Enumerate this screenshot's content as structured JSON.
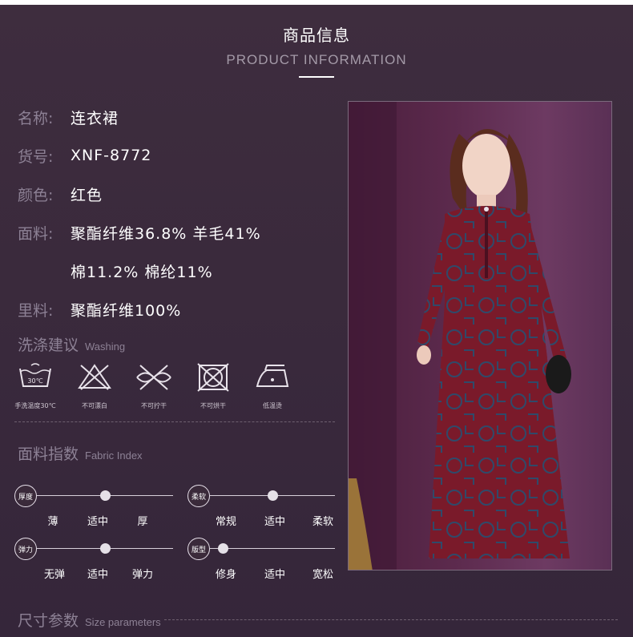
{
  "header": {
    "title_cn": "商品信息",
    "title_en": "PRODUCT INFORMATION"
  },
  "info": {
    "name_label": "名称:",
    "name_value": "连衣裙",
    "sku_label": "货号:",
    "sku_value": "XNF-8772",
    "color_label": "颜色:",
    "color_value": "红色",
    "fabric_label": "面料:",
    "fabric_value_1": "聚酯纤维36.8% 羊毛41%",
    "fabric_value_2": "棉11.2% 棉纶11%",
    "lining_label": "里料:",
    "lining_value": "聚酯纤维100%"
  },
  "washing": {
    "title_cn": "洗涤建议",
    "title_en": "Washing",
    "items": [
      {
        "icon": "hand-wash-30-icon",
        "caption": "手洗温度30℃"
      },
      {
        "icon": "no-bleach-icon",
        "caption": "不可漂白"
      },
      {
        "icon": "no-wring-icon",
        "caption": "不可拧干"
      },
      {
        "icon": "no-tumble-dry-icon",
        "caption": "不可烘干"
      },
      {
        "icon": "low-iron-icon",
        "caption": "低温烫"
      }
    ]
  },
  "fabric_index": {
    "title_cn": "面料指数",
    "title_en": "Fabric Index",
    "thickness": {
      "badge": "厚度",
      "labels": [
        "薄",
        "适中",
        "厚"
      ],
      "level": 0.5
    },
    "softness": {
      "badge": "柔软",
      "labels": [
        "常规",
        "适中",
        "柔软"
      ],
      "level": 0.5
    },
    "elasticity": {
      "badge": "弹力",
      "labels": [
        "无弹",
        "适中",
        "弹力"
      ],
      "level": 0.5
    },
    "fit": {
      "badge": "版型",
      "labels": [
        "修身",
        "适中",
        "宽松"
      ],
      "level": 0.1
    }
  },
  "size_params": {
    "title_cn": "尺寸参数",
    "title_en": "Size parameters"
  },
  "colors": {
    "background": "#3a2a3a",
    "label": "#8d8195",
    "dress": "#7a1a2a"
  }
}
